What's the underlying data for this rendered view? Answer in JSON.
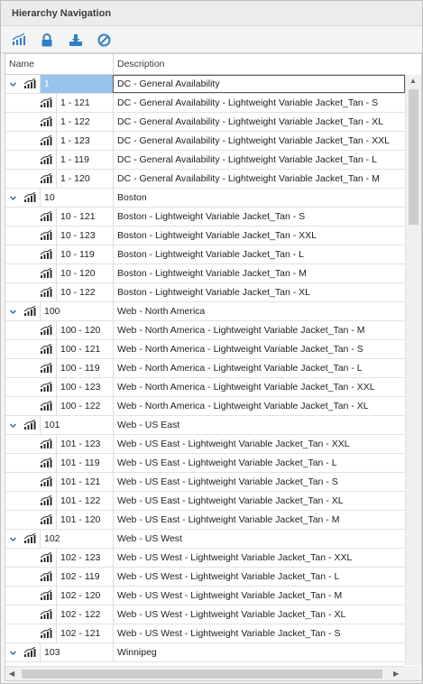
{
  "panel": {
    "title": "Hierarchy Navigation"
  },
  "toolbar": {
    "buttons": [
      {
        "icon": "hierarchy-icon"
      },
      {
        "icon": "lock-icon"
      },
      {
        "icon": "import-icon"
      },
      {
        "icon": "cancel-icon"
      }
    ]
  },
  "grid": {
    "columns": {
      "name": "Name",
      "description": "Description"
    },
    "groups": [
      {
        "name": "1",
        "description": "DC - General Availability",
        "selected": true,
        "children": [
          {
            "name": "1 - 121",
            "description": "DC - General Availability - Lightweight Variable Jacket_Tan - S"
          },
          {
            "name": "1 - 122",
            "description": "DC - General Availability - Lightweight Variable Jacket_Tan - XL"
          },
          {
            "name": "1 - 123",
            "description": "DC - General Availability - Lightweight Variable Jacket_Tan - XXL"
          },
          {
            "name": "1 - 119",
            "description": "DC - General Availability - Lightweight Variable Jacket_Tan - L"
          },
          {
            "name": "1 - 120",
            "description": "DC - General Availability - Lightweight Variable Jacket_Tan - M"
          }
        ]
      },
      {
        "name": "10",
        "description": "Boston",
        "children": [
          {
            "name": "10 - 121",
            "description": "Boston - Lightweight Variable Jacket_Tan - S"
          },
          {
            "name": "10 - 123",
            "description": "Boston - Lightweight Variable Jacket_Tan - XXL"
          },
          {
            "name": "10 - 119",
            "description": "Boston - Lightweight Variable Jacket_Tan - L"
          },
          {
            "name": "10 - 120",
            "description": "Boston - Lightweight Variable Jacket_Tan - M"
          },
          {
            "name": "10 - 122",
            "description": "Boston - Lightweight Variable Jacket_Tan - XL"
          }
        ]
      },
      {
        "name": "100",
        "description": "Web - North America",
        "children": [
          {
            "name": "100 - 120",
            "description": "Web - North America - Lightweight Variable Jacket_Tan - M"
          },
          {
            "name": "100 - 121",
            "description": "Web - North America - Lightweight Variable Jacket_Tan - S"
          },
          {
            "name": "100 - 119",
            "description": "Web - North America - Lightweight Variable Jacket_Tan - L"
          },
          {
            "name": "100 - 123",
            "description": "Web - North America - Lightweight Variable Jacket_Tan - XXL"
          },
          {
            "name": "100 - 122",
            "description": "Web - North America - Lightweight Variable Jacket_Tan - XL"
          }
        ]
      },
      {
        "name": "101",
        "description": "Web - US East",
        "children": [
          {
            "name": "101 - 123",
            "description": "Web - US East - Lightweight Variable Jacket_Tan - XXL"
          },
          {
            "name": "101 - 119",
            "description": "Web - US East - Lightweight Variable Jacket_Tan - L"
          },
          {
            "name": "101 - 121",
            "description": "Web - US East - Lightweight Variable Jacket_Tan - S"
          },
          {
            "name": "101 - 122",
            "description": "Web - US East - Lightweight Variable Jacket_Tan - XL"
          },
          {
            "name": "101 - 120",
            "description": "Web - US East - Lightweight Variable Jacket_Tan - M"
          }
        ]
      },
      {
        "name": "102",
        "description": "Web - US West",
        "children": [
          {
            "name": "102 - 123",
            "description": "Web - US West - Lightweight Variable Jacket_Tan - XXL"
          },
          {
            "name": "102 - 119",
            "description": "Web - US West - Lightweight Variable Jacket_Tan - L"
          },
          {
            "name": "102 - 120",
            "description": "Web - US West - Lightweight Variable Jacket_Tan - M"
          },
          {
            "name": "102 - 122",
            "description": "Web - US West - Lightweight Variable Jacket_Tan - XL"
          },
          {
            "name": "102 - 121",
            "description": "Web - US West - Lightweight Variable Jacket_Tan - S"
          }
        ]
      },
      {
        "name": "103",
        "description": "Winnipeg",
        "children": []
      }
    ]
  },
  "colors": {
    "selection": "#99c3eb",
    "icon": "#2b2b2b",
    "toolbar_icon": "#2f7fc7"
  }
}
